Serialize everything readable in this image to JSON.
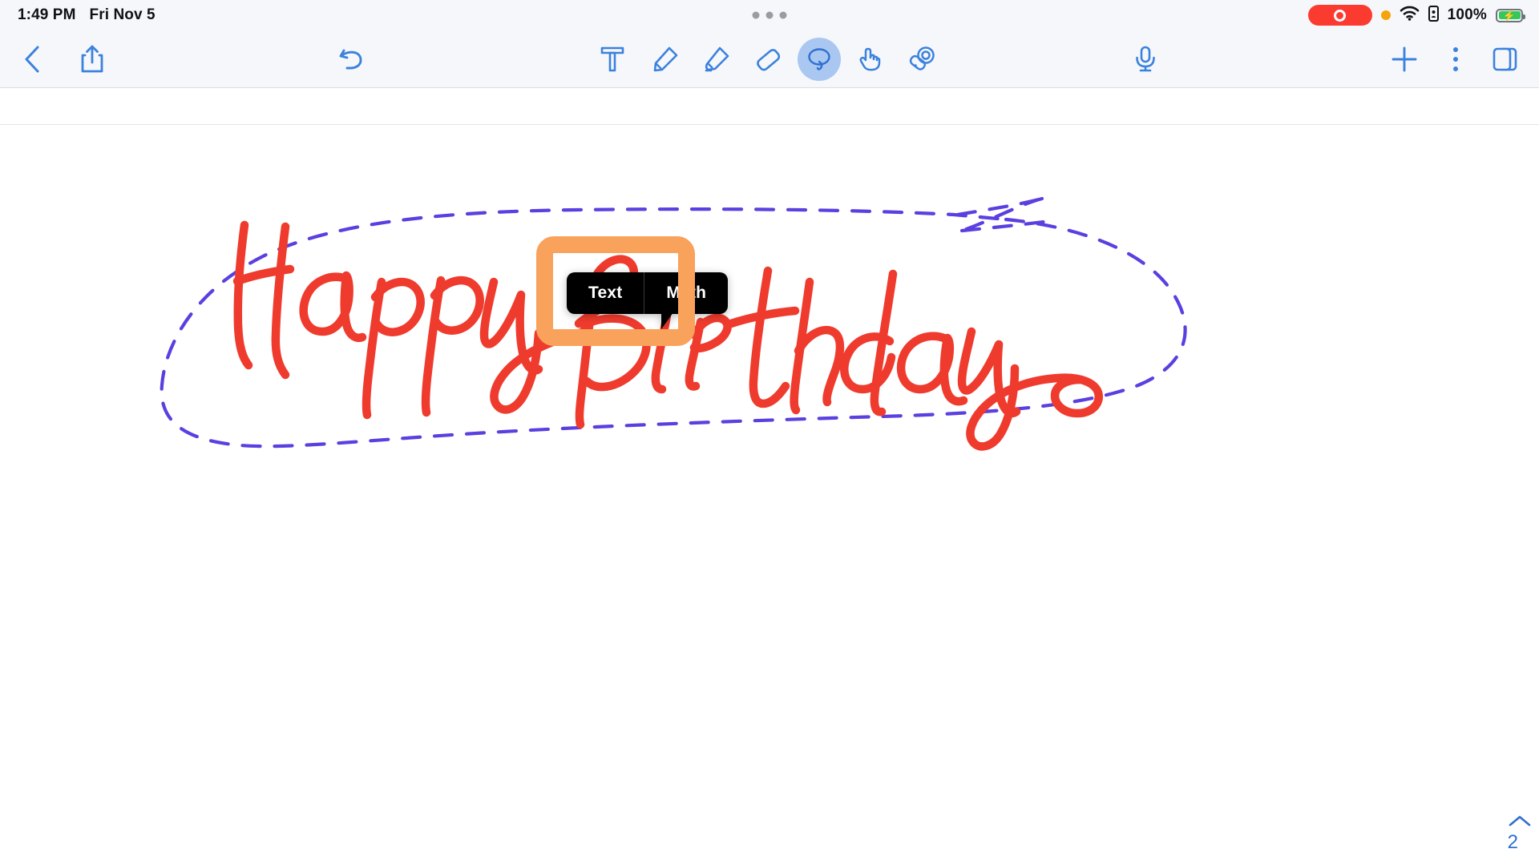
{
  "status_bar": {
    "time": "1:49 PM",
    "date": "Fri Nov 5",
    "battery_percent": "100%",
    "icons": {
      "recording_pill": "screen-recording-pill",
      "privacy_dot": "orange-privacy-dot",
      "wifi": "wifi-icon",
      "lock": "battery-lock-icon",
      "battery": "battery-charging-icon",
      "multitask": "multitasking-dots"
    },
    "colors": {
      "recording_red": "#fc3b30",
      "privacy_orange": "#f7a30a",
      "battery_green": "#34c759",
      "bar_background": "#f6f7fb"
    }
  },
  "toolbar": {
    "back_label": "back-chevron",
    "share_label": "share",
    "undo_label": "undo",
    "tools": [
      {
        "name": "text",
        "label": "Text tool",
        "active": false
      },
      {
        "name": "pen",
        "label": "Pen tool",
        "active": false
      },
      {
        "name": "highlighter",
        "label": "Highlighter tool",
        "active": false
      },
      {
        "name": "eraser",
        "label": "Eraser tool",
        "active": false
      },
      {
        "name": "lasso",
        "label": "Lasso select tool",
        "active": true
      },
      {
        "name": "hand",
        "label": "Hand / pointer tool",
        "active": false
      },
      {
        "name": "laser",
        "label": "Laser pointer tool",
        "active": false
      }
    ],
    "mic_label": "microphone",
    "add_label": "add",
    "more_label": "more-options",
    "pages_label": "page-thumbnails",
    "accent_color": "#3b82dd",
    "active_tool_background": "#aac7f2"
  },
  "popup": {
    "options": [
      {
        "label": "Text"
      },
      {
        "label": "Math"
      }
    ],
    "background": "#000000",
    "text_color": "#ffffff"
  },
  "highlight": {
    "label": "text-option-highlight",
    "color": "#f9a25c",
    "border_width": "21px"
  },
  "canvas": {
    "handwriting": {
      "text": "Happy Birthday",
      "color": "#ef3b2d",
      "style": "handwritten-script"
    },
    "selection": {
      "type": "lasso-selection",
      "stroke_color": "#5b3fe0",
      "dash": "dashed"
    }
  },
  "page_nav": {
    "up_label": "previous-page",
    "page_number": "2"
  }
}
